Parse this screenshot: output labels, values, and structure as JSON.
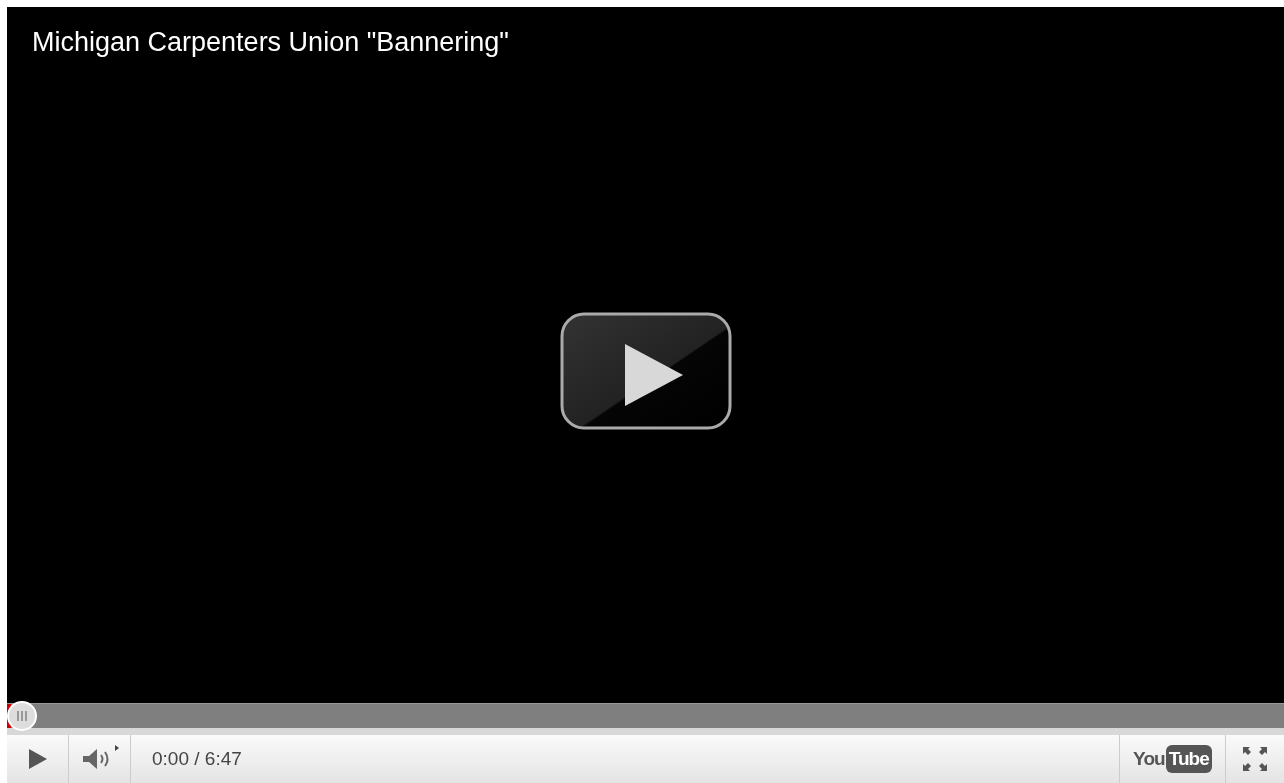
{
  "video": {
    "title": "Michigan Carpenters Union \"Bannering\""
  },
  "progress": {
    "level": 0
  },
  "controls": {
    "time": "0:00 / 6:47",
    "logo": {
      "first": "You",
      "second": "Tube"
    }
  }
}
